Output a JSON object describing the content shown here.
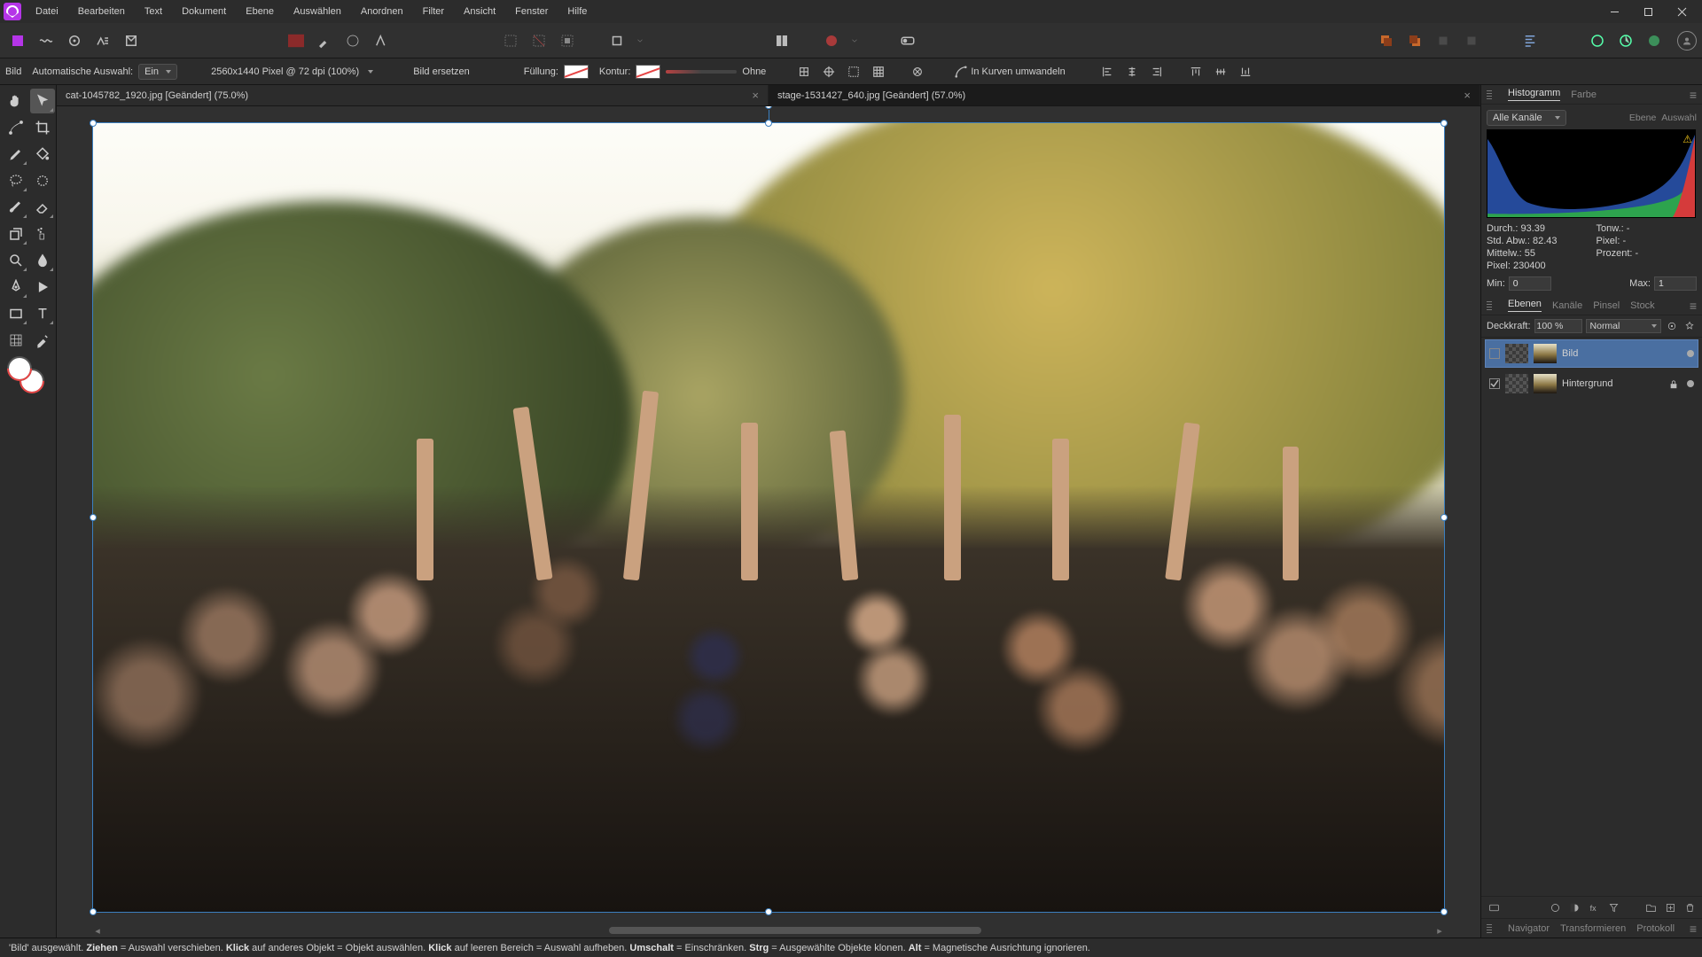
{
  "menu": {
    "items": [
      "Datei",
      "Bearbeiten",
      "Text",
      "Dokument",
      "Ebene",
      "Auswählen",
      "Anordnen",
      "Filter",
      "Ansicht",
      "Fenster",
      "Hilfe"
    ]
  },
  "context": {
    "type_label": "Bild",
    "auto_sel_label": "Automatische Auswahl:",
    "auto_sel_value": "Ein",
    "dims": "2560x1440 Pixel @ 72 dpi (100%)",
    "replace": "Bild ersetzen",
    "fill_label": "Füllung:",
    "stroke_label": "Kontur:",
    "stroke_width": "Ohne",
    "curves": "In Kurven umwandeln"
  },
  "tabs": [
    {
      "title": "cat-1045782_1920.jpg [Geändert] (75.0%)",
      "active": false
    },
    {
      "title": "stage-1531427_640.jpg [Geändert] (57.0%)",
      "active": true
    }
  ],
  "hist_panel": {
    "tabs": [
      "Histogramm",
      "Farbe"
    ],
    "channels": "Alle Kanäle",
    "btn_layer": "Ebene",
    "btn_sel": "Auswahl",
    "stats": {
      "durch": "Durch.: 93.39",
      "std": "Std. Abw.: 82.43",
      "mittel": "Mittelw.: 55",
      "pixel": "Pixel: 230400",
      "tonw": "Tonw.: -",
      "pixel2": "Pixel: -",
      "prozent": "Prozent: -"
    },
    "min_label": "Min:",
    "min_val": "0",
    "max_label": "Max:",
    "max_val": "1"
  },
  "layers_panel": {
    "tabs": [
      "Ebenen",
      "Kanäle",
      "Pinsel",
      "Stock"
    ],
    "opacity_label": "Deckkraft:",
    "opacity_val": "100 %",
    "blend_mode": "Normal",
    "layers": [
      {
        "name": "Bild",
        "selected": true,
        "locked": false,
        "visible": true
      },
      {
        "name": "Hintergrund",
        "selected": false,
        "locked": true,
        "visible": true
      }
    ]
  },
  "btm_tabs": [
    "Navigator",
    "Transformieren",
    "Protokoll"
  ],
  "status": {
    "s1a": "'Bild' ausgewählt. ",
    "k1": "Ziehen",
    "s1b": " = Auswahl verschieben. ",
    "k2": "Klick",
    "s2": " auf anderes Objekt = Objekt auswählen. ",
    "k3": "Klick",
    "s3": " auf leeren Bereich = Auswahl aufheben. ",
    "k4": "Umschalt",
    "s4": " = Einschränken. ",
    "k5": "Strg",
    "s5": " = Ausgewählte Objekte klonen. ",
    "k6": "Alt",
    "s6": " = Magnetische Ausrichtung ignorieren."
  }
}
